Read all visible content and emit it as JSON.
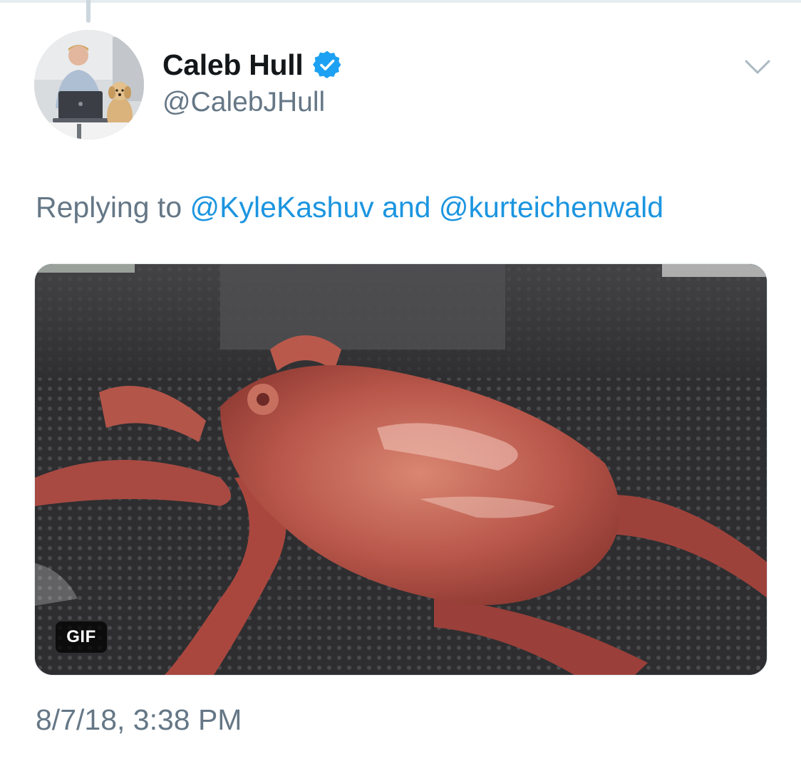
{
  "thread": {
    "connector_color": "#ccd6dd"
  },
  "tweet": {
    "author": {
      "display_name": "Caleb Hull",
      "handle": "@CalebJHull",
      "verified": true,
      "verified_badge_color": "#1da1f2"
    },
    "menu_icon": "chevron-down-icon",
    "reply_context": {
      "prefix": "Replying to",
      "mentions": [
        "@KyleKashuv",
        "@kurteichenwald"
      ],
      "joiner": "and"
    },
    "media": {
      "type_badge": "GIF"
    },
    "timestamp": "8/7/18, 3:38 PM"
  },
  "colors": {
    "text_primary": "#14171a",
    "text_secondary": "#657786",
    "link": "#1b95e0"
  }
}
